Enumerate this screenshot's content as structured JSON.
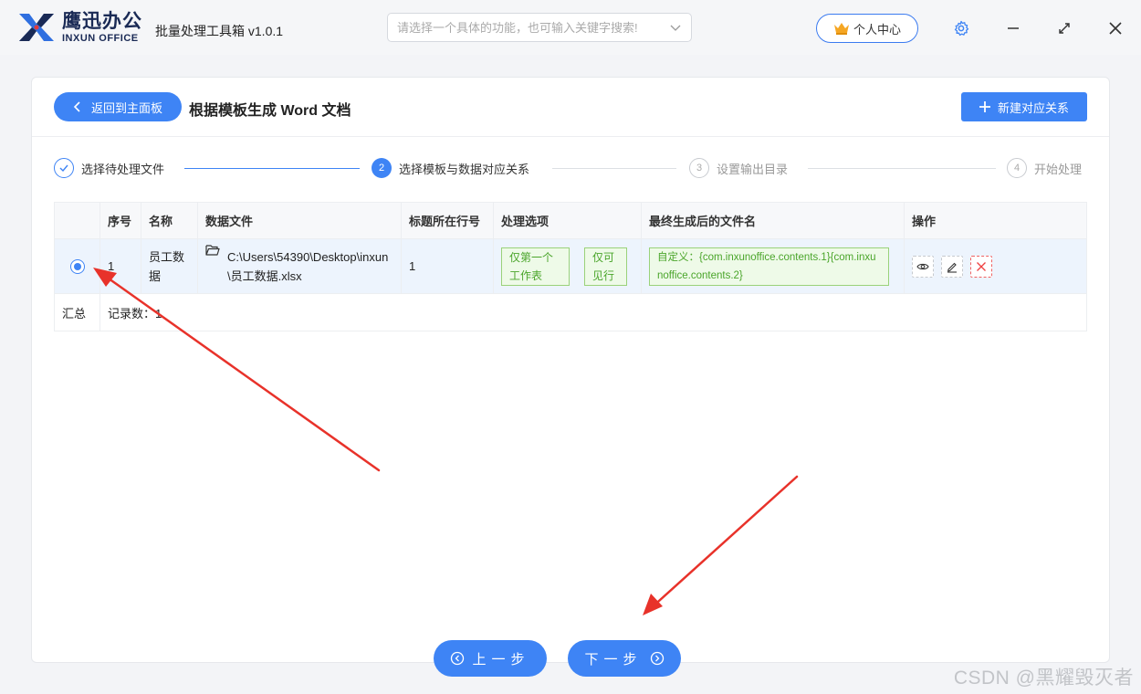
{
  "app": {
    "brand_cn": "鹰迅办公",
    "brand_en": "INXUN OFFICE",
    "title": "批量处理工具箱 v1.0.1",
    "search_placeholder": "请选择一个具体的功能，也可输入关键字搜索!",
    "personal_center": "个人中心"
  },
  "header": {
    "back_label": "返回到主面板",
    "page_title": "根据模板生成 Word 文档",
    "new_label": "新建对应关系"
  },
  "steps": [
    {
      "num": "",
      "label": "选择待处理文件",
      "state": "done"
    },
    {
      "num": "2",
      "label": "选择模板与数据对应关系",
      "state": "active"
    },
    {
      "num": "3",
      "label": "设置输出目录",
      "state": "todo"
    },
    {
      "num": "4",
      "label": "开始处理",
      "state": "todo"
    }
  ],
  "table": {
    "headers": [
      "",
      "序号",
      "名称",
      "数据文件",
      "标题所在行号",
      "处理选项",
      "最终生成后的文件名",
      "操作"
    ],
    "rows": [
      {
        "index": "1",
        "name": "员工数据",
        "data_file": "C:\\Users\\54390\\Desktop\\inxun\\员工数据.xlsx",
        "title_row": "1",
        "option_1": "仅第一个工作表",
        "option_2": "仅可见行",
        "filename": "自定义：{com.inxunoffice.contents.1}{com.inxunoffice.contents.2}"
      }
    ],
    "summary_label": "汇总",
    "summary_value": "记录数：1"
  },
  "footer": {
    "prev_label": "上一步",
    "next_label": "下一步"
  },
  "watermark": "CSDN @黑耀毁灭者",
  "colors": {
    "accent": "#3e84f5",
    "tag_green": "#4aa52a",
    "arrow_red": "#e8322a"
  }
}
